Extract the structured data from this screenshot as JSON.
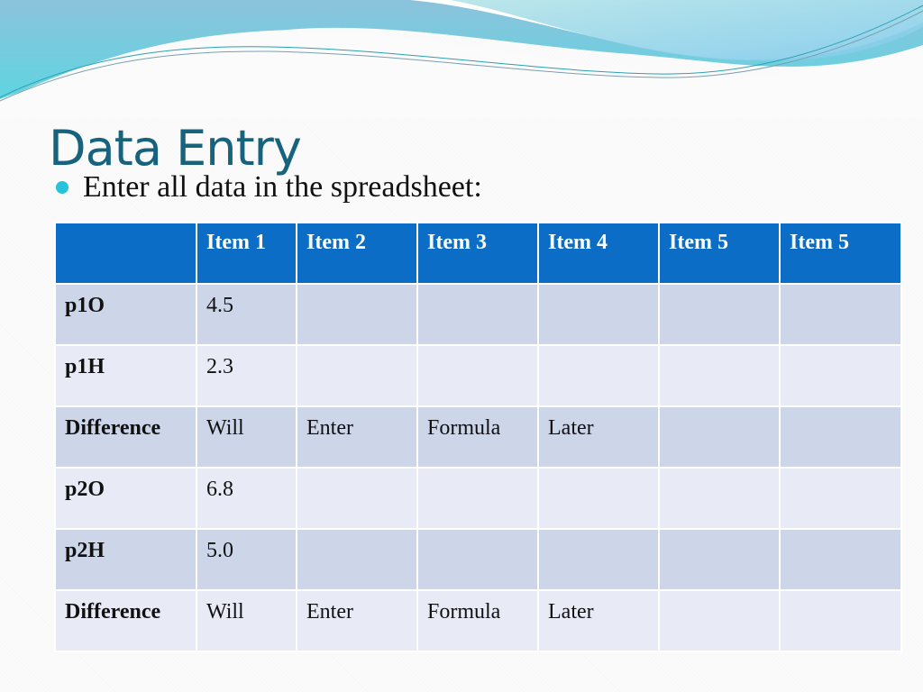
{
  "slide": {
    "title": "Data Entry",
    "bullet": "Enter all data in the spreadsheet:",
    "colors": {
      "title": "#17637e",
      "bullet_dot": "#26c4dc",
      "header_fill": "#0b6dc6",
      "row_band_dark": "#cdd5e8",
      "row_band_light": "#e8ebf5"
    }
  },
  "table": {
    "columns": [
      "",
      "Item 1",
      "Item 2",
      "Item 3",
      "Item 4",
      "Item 5",
      "Item 5"
    ],
    "rows": [
      {
        "label": "p1O",
        "cells": [
          "4.5",
          "",
          "",
          "",
          "",
          ""
        ]
      },
      {
        "label": "p1H",
        "cells": [
          "2.3",
          "",
          "",
          "",
          "",
          ""
        ]
      },
      {
        "label": "Difference",
        "cells": [
          "Will",
          "Enter",
          "Formula",
          "Later",
          "",
          ""
        ]
      },
      {
        "label": "p2O",
        "cells": [
          "6.8",
          "",
          "",
          "",
          "",
          ""
        ]
      },
      {
        "label": "p2H",
        "cells": [
          "5.0",
          "",
          "",
          "",
          "",
          ""
        ]
      },
      {
        "label": "Difference",
        "cells": [
          "Will",
          "Enter",
          "Formula",
          "Later",
          "",
          ""
        ]
      }
    ]
  }
}
